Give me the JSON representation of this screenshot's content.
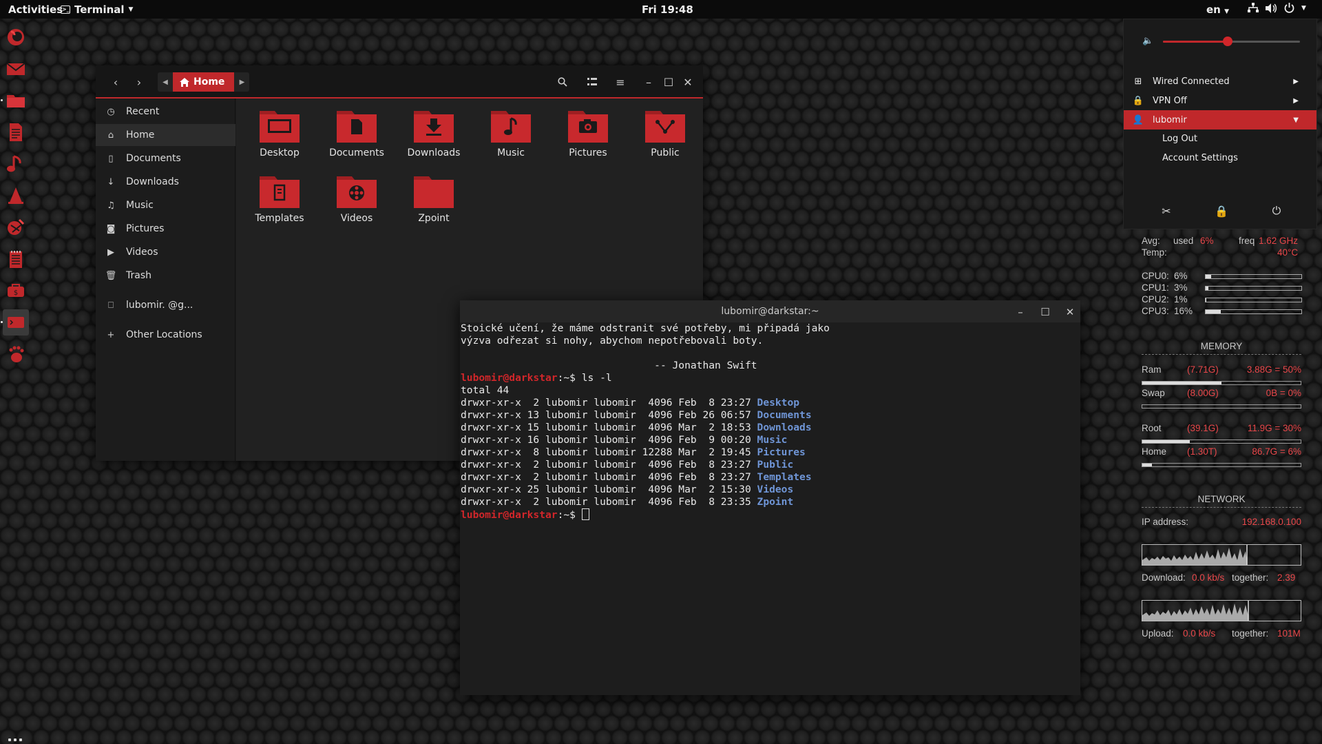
{
  "topbar": {
    "activities": "Activities",
    "app_name": "Terminal",
    "clock": "Fri 19:48",
    "language": "en"
  },
  "dock": {
    "items": [
      {
        "name": "firefox",
        "icon": "firefox-icon"
      },
      {
        "name": "mail",
        "icon": "mail-icon"
      },
      {
        "name": "files",
        "icon": "folder-icon"
      },
      {
        "name": "documents",
        "icon": "document-icon"
      },
      {
        "name": "music",
        "icon": "music-icon"
      },
      {
        "name": "vlc",
        "icon": "cone-icon"
      },
      {
        "name": "gimp",
        "icon": "brush-icon"
      },
      {
        "name": "notes",
        "icon": "notepad-icon"
      },
      {
        "name": "software",
        "icon": "store-icon"
      },
      {
        "name": "terminal",
        "icon": "terminal-icon"
      },
      {
        "name": "gnome",
        "icon": "foot-icon"
      }
    ]
  },
  "files": {
    "path_label": "Home",
    "sidebar": [
      {
        "label": "Recent",
        "icon": "clock-icon"
      },
      {
        "label": "Home",
        "icon": "home-icon"
      },
      {
        "label": "Documents",
        "icon": "document-icon"
      },
      {
        "label": "Downloads",
        "icon": "download-icon"
      },
      {
        "label": "Music",
        "icon": "music-icon"
      },
      {
        "label": "Pictures",
        "icon": "camera-icon"
      },
      {
        "label": "Videos",
        "icon": "video-icon"
      },
      {
        "label": "Trash",
        "icon": "trash-icon"
      },
      {
        "label": "lubomir.         @g...",
        "icon": "account-icon"
      },
      {
        "label": "Other Locations",
        "icon": "plus-icon"
      }
    ],
    "folders": [
      {
        "label": "Desktop",
        "icon": "desktop-folder-icon"
      },
      {
        "label": "Documents",
        "icon": "documents-folder-icon"
      },
      {
        "label": "Downloads",
        "icon": "downloads-folder-icon"
      },
      {
        "label": "Music",
        "icon": "music-folder-icon"
      },
      {
        "label": "Pictures",
        "icon": "pictures-folder-icon"
      },
      {
        "label": "Public",
        "icon": "public-folder-icon"
      },
      {
        "label": "Templates",
        "icon": "templates-folder-icon"
      },
      {
        "label": "Videos",
        "icon": "videos-folder-icon"
      },
      {
        "label": "Zpoint",
        "icon": "folder-icon"
      }
    ]
  },
  "terminal": {
    "title": "lubomir@darkstar:~",
    "quote_line1": "Stoické učení, že máme odstranit své potřeby, mi připadá jako",
    "quote_line2": "výzva odřezat si nohy, abychom nepotřebovali boty.",
    "quote_author": "                                -- Jonathan Swift",
    "prompt": "lubomir@darkstar",
    "prompt_suffix": ":~$ ",
    "command": "ls -l",
    "total": "total 44",
    "listing": [
      {
        "meta": "drwxr-xr-x  2 lubomir lubomir  4096 Feb  8 23:27 ",
        "name": "Desktop"
      },
      {
        "meta": "drwxr-xr-x 13 lubomir lubomir  4096 Feb 26 06:57 ",
        "name": "Documents"
      },
      {
        "meta": "drwxr-xr-x 15 lubomir lubomir  4096 Mar  2 18:53 ",
        "name": "Downloads"
      },
      {
        "meta": "drwxr-xr-x 16 lubomir lubomir  4096 Feb  9 00:20 ",
        "name": "Music"
      },
      {
        "meta": "drwxr-xr-x  8 lubomir lubomir 12288 Mar  2 19:45 ",
        "name": "Pictures"
      },
      {
        "meta": "drwxr-xr-x  2 lubomir lubomir  4096 Feb  8 23:27 ",
        "name": "Public"
      },
      {
        "meta": "drwxr-xr-x  2 lubomir lubomir  4096 Feb  8 23:27 ",
        "name": "Templates"
      },
      {
        "meta": "drwxr-xr-x 25 lubomir lubomir  4096 Mar  2 15:30 ",
        "name": "Videos"
      },
      {
        "meta": "drwxr-xr-x  2 lubomir lubomir  4096 Feb  8 23:35 ",
        "name": "Zpoint"
      }
    ]
  },
  "system_menu": {
    "volume_level": 0.47,
    "wired": "Wired Connected",
    "vpn": "VPN Off",
    "user": "lubomir",
    "logout": "Log Out",
    "account_settings": "Account Settings"
  },
  "conky": {
    "avg_label": "Avg:",
    "used_label": "used",
    "used_value": "6%",
    "freq_label": "freq",
    "freq_value": "1.62 GHz",
    "temp_label": "Temp:",
    "temp_value": "40°C",
    "cpus": [
      {
        "label": "CPU0:",
        "value": "6%",
        "level": 0.06
      },
      {
        "label": "CPU1:",
        "value": "3%",
        "level": 0.03
      },
      {
        "label": "CPU2:",
        "value": "1%",
        "level": 0.01
      },
      {
        "label": "CPU3:",
        "value": "16%",
        "level": 0.16
      }
    ],
    "memory_heading": "MEMORY",
    "memory": [
      {
        "label": "Ram",
        "total": "(7.71G)",
        "used": "3.88G = 50%",
        "level": 0.5
      },
      {
        "label": "Swap",
        "total": "(8.00G)",
        "used": "0B = 0%",
        "level": 0.0
      },
      {
        "label": "Root",
        "total": "(39.1G)",
        "used": "11.9G = 30%",
        "level": 0.3
      },
      {
        "label": "Home",
        "total": "(1.30T)",
        "used": "86.7G = 6%",
        "level": 0.06
      }
    ],
    "network_heading": "NETWORK",
    "ip_label": "IP address:",
    "ip_value": "192.168.0.100",
    "download_label": "Download:",
    "download_value": "0.0 kb/s",
    "download_total_label": "together:",
    "download_total_value": "2.39",
    "upload_label": "Upload:",
    "upload_value": "0.0 kb/s",
    "upload_total_label": "together:",
    "upload_total_value": "101M"
  },
  "colors": {
    "accent": "#c0282b",
    "prompt": "#d0262a",
    "dir": "#6f95d6",
    "conky_value": "#e8474a"
  }
}
